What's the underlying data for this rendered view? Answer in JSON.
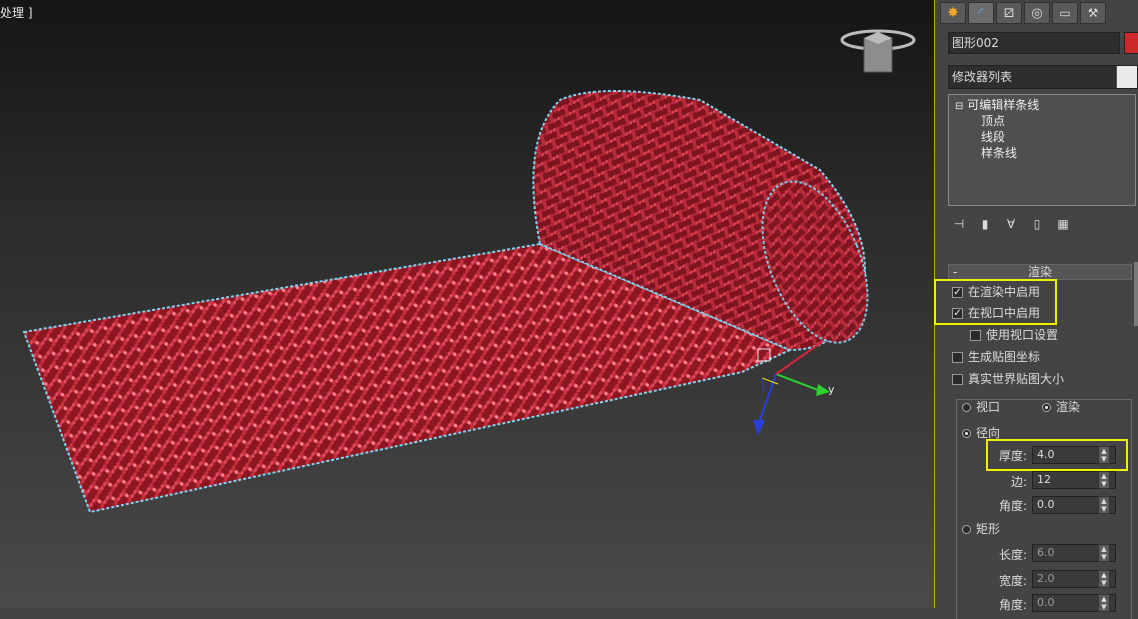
{
  "viewport": {
    "label": "处理 ]",
    "accent_color": "#d4263a",
    "gizmo_label": "y"
  },
  "panel": {
    "tabs": [
      "create-tab",
      "modify-tab",
      "hierarchy-tab",
      "motion-tab",
      "display-tab",
      "utilities-tab"
    ],
    "object_name": "图形002",
    "object_color": "#cc2a2a",
    "modifier_list": "修改器列表",
    "stack": {
      "root": "可编辑样条线",
      "items": [
        "顶点",
        "线段",
        "样条线"
      ]
    },
    "rollout": {
      "title": "渲染",
      "collapse": "-",
      "enable_in_renderer": "在渲染中启用",
      "enable_in_viewport": "在视口中启用",
      "use_viewport_settings": "使用视口设置",
      "generate_mapping": "生成贴图坐标",
      "real_world_map": "真实世界贴图大小",
      "viewport_radio": "视口",
      "render_radio": "渲染",
      "radial": "径向",
      "thickness_label": "厚度:",
      "thickness_value": "4.0",
      "sides_label": "边:",
      "sides_value": "12",
      "angle_label": "角度:",
      "angle_value": "0.0",
      "rectangular": "矩形",
      "length_label": "长度:",
      "length_value": "6.0",
      "width_label": "宽度:",
      "width_value": "2.0",
      "angle2_label": "角度:",
      "angle2_value": "0.0"
    },
    "highlight_color": "#f0f000"
  }
}
